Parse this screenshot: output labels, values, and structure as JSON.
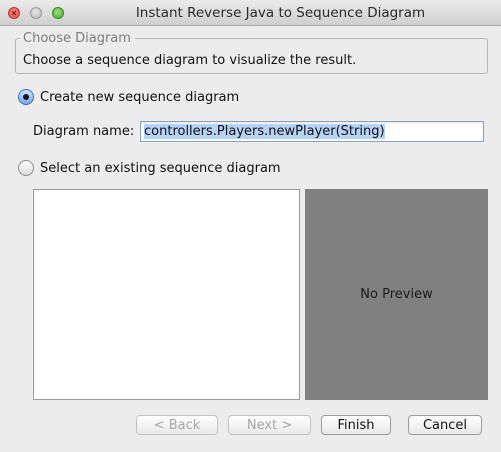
{
  "window": {
    "title": "Instant Reverse Java to Sequence Diagram"
  },
  "group": {
    "legend": "Choose Diagram",
    "description": "Choose a sequence diagram to visualize the result."
  },
  "options": {
    "create_new": {
      "label": "Create new sequence diagram",
      "checked": true
    },
    "select_existing": {
      "label": "Select an existing sequence diagram",
      "checked": false
    }
  },
  "diagram_name": {
    "label": "Diagram name:",
    "value": "controllers.Players.newPlayer(String)"
  },
  "preview": {
    "text": "No Preview",
    "background": "#808080"
  },
  "buttons": {
    "back": "< Back",
    "next": "Next >",
    "finish": "Finish",
    "cancel": "Cancel"
  },
  "colors": {
    "selection": "#b5d2f7",
    "window_bg": "#ececec"
  }
}
